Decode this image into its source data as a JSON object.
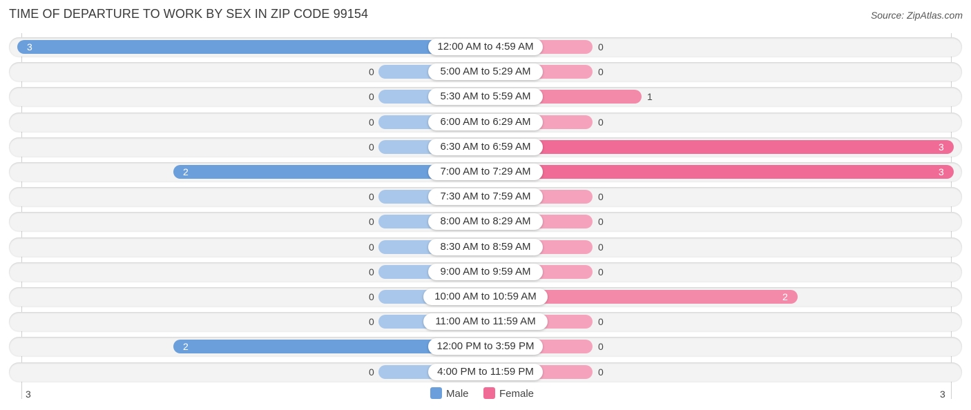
{
  "title": "TIME OF DEPARTURE TO WORK BY SEX IN ZIP CODE 99154",
  "source": "Source: ZipAtlas.com",
  "colors": {
    "male": "#6a9fdb",
    "male_zero": "#a9c7ea",
    "female": "#f06b95",
    "female_light": "#f5a3bd"
  },
  "chart_data": {
    "type": "bar",
    "orientation": "horizontal-diverging",
    "title": "TIME OF DEPARTURE TO WORK BY SEX IN ZIP CODE 99154",
    "categories": [
      "12:00 AM to 4:59 AM",
      "5:00 AM to 5:29 AM",
      "5:30 AM to 5:59 AM",
      "6:00 AM to 6:29 AM",
      "6:30 AM to 6:59 AM",
      "7:00 AM to 7:29 AM",
      "7:30 AM to 7:59 AM",
      "8:00 AM to 8:29 AM",
      "8:30 AM to 8:59 AM",
      "9:00 AM to 9:59 AM",
      "10:00 AM to 10:59 AM",
      "11:00 AM to 11:59 AM",
      "12:00 PM to 3:59 PM",
      "4:00 PM to 11:59 PM"
    ],
    "series": [
      {
        "name": "Male",
        "values": [
          3,
          0,
          0,
          0,
          0,
          2,
          0,
          0,
          0,
          0,
          0,
          0,
          2,
          0
        ]
      },
      {
        "name": "Female",
        "values": [
          0,
          0,
          1,
          0,
          3,
          3,
          0,
          0,
          0,
          0,
          2,
          0,
          0,
          0
        ]
      }
    ],
    "axis_range": [
      3,
      3
    ],
    "axis_labels": {
      "left": "3",
      "right": "3"
    },
    "legend": {
      "placement": "bottom-center",
      "entries": [
        "Male",
        "Female"
      ]
    },
    "grid": false
  }
}
